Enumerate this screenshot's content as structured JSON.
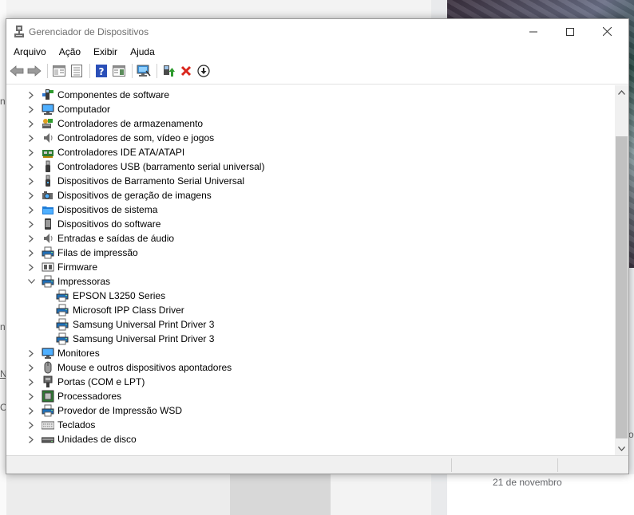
{
  "window": {
    "title": "Gerenciador de Dispositivos",
    "controls": {
      "minimize": "—",
      "maximize": "☐",
      "close": "✕"
    }
  },
  "menu": [
    "Arquivo",
    "Ação",
    "Exibir",
    "Ajuda"
  ],
  "toolbar": {
    "buttons": [
      "back-icon",
      "forward-icon",
      "properties-view-icon",
      "list-view-icon",
      "help-icon",
      "action-pane-icon",
      "monitor-scan-icon",
      "update-driver-icon",
      "uninstall-icon",
      "download-icon"
    ]
  },
  "tree": {
    "items": [
      {
        "label": "Componentes de software",
        "icon": "software-component-icon",
        "expanded": false
      },
      {
        "label": "Computador",
        "icon": "computer-icon",
        "expanded": false
      },
      {
        "label": "Controladores de armazenamento",
        "icon": "storage-controller-icon",
        "expanded": false
      },
      {
        "label": "Controladores de som, vídeo e jogos",
        "icon": "speaker-icon",
        "expanded": false
      },
      {
        "label": "Controladores IDE ATA/ATAPI",
        "icon": "ide-controller-icon",
        "expanded": false
      },
      {
        "label": "Controladores USB (barramento serial universal)",
        "icon": "usb-icon",
        "expanded": false
      },
      {
        "label": "Dispositivos de Barramento Serial Universal",
        "icon": "usb-device-icon",
        "expanded": false
      },
      {
        "label": "Dispositivos de geração de imagens",
        "icon": "camera-icon",
        "expanded": false
      },
      {
        "label": "Dispositivos de sistema",
        "icon": "folder-icon",
        "expanded": false
      },
      {
        "label": "Dispositivos do software",
        "icon": "phone-icon",
        "expanded": false
      },
      {
        "label": "Entradas e saídas de áudio",
        "icon": "speaker-icon",
        "expanded": false
      },
      {
        "label": "Filas de impressão",
        "icon": "printer-icon",
        "expanded": false
      },
      {
        "label": "Firmware",
        "icon": "firmware-icon",
        "expanded": false
      },
      {
        "label": "Impressoras",
        "icon": "printer-icon",
        "expanded": true,
        "children": [
          "EPSON L3250 Series",
          "Microsoft IPP Class Driver",
          "Samsung Universal Print Driver 3",
          "Samsung Universal Print Driver 3"
        ]
      },
      {
        "label": "Monitores",
        "icon": "monitor-icon",
        "expanded": false
      },
      {
        "label": "Mouse e outros dispositivos apontadores",
        "icon": "mouse-icon",
        "expanded": false
      },
      {
        "label": "Portas (COM e LPT)",
        "icon": "port-icon",
        "expanded": false
      },
      {
        "label": "Processadores",
        "icon": "processor-icon",
        "expanded": false
      },
      {
        "label": "Provedor de Impressão WSD",
        "icon": "printer-icon",
        "expanded": false
      },
      {
        "label": "Teclados",
        "icon": "keyboard-icon",
        "expanded": false
      },
      {
        "label": "Unidades de disco",
        "icon": "disk-drive-icon",
        "expanded": false
      }
    ]
  },
  "background": {
    "date_text": "21 de novembro",
    "fragments": [
      "n",
      "N",
      "C",
      "n",
      "ro"
    ]
  },
  "colors": {
    "accent_blue": "#1e7bd6",
    "green": "#2e9b2e",
    "red": "#d9261c",
    "scroll_thumb": "#c1c1c1"
  }
}
